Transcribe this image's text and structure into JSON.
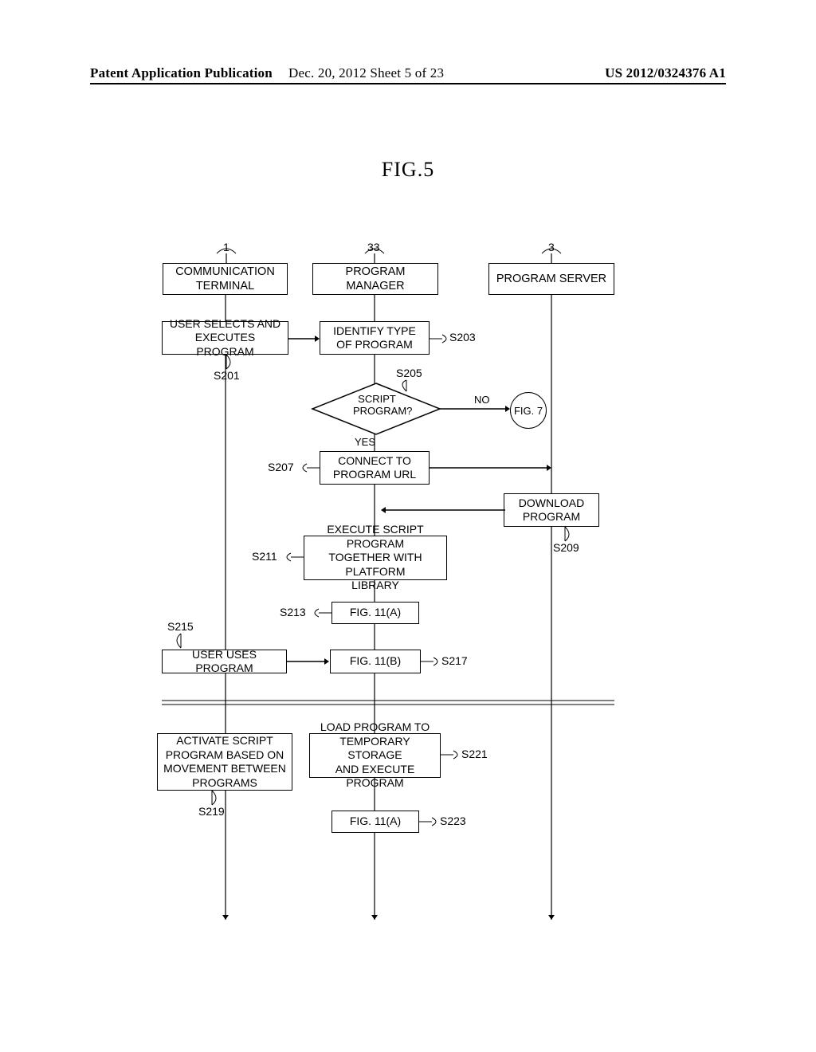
{
  "header": {
    "left": "Patent Application Publication",
    "mid": "Dec. 20, 2012  Sheet 5 of 23",
    "right": "US 2012/0324376 A1"
  },
  "figure_title": "FIG.5",
  "swim": {
    "col1": {
      "ref": "1",
      "title": "COMMUNICATION\nTERMINAL"
    },
    "col2": {
      "ref": "33",
      "title": "PROGRAM MANAGER"
    },
    "col3": {
      "ref": "3",
      "title": "PROGRAM SERVER"
    }
  },
  "steps": {
    "s201": {
      "id": "S201",
      "text": "USER SELECTS AND\nEXECUTES PROGRAM"
    },
    "s203": {
      "id": "S203",
      "text": "IDENTIFY TYPE\nOF PROGRAM"
    },
    "s205": {
      "id": "S205",
      "text": "SCRIPT\nPROGRAM?",
      "yes": "YES",
      "no": "NO",
      "off_page": "FIG. 7"
    },
    "s207": {
      "id": "S207",
      "text": "CONNECT TO\nPROGRAM URL"
    },
    "s209": {
      "id": "S209",
      "text": "DOWNLOAD\nPROGRAM"
    },
    "s211": {
      "id": "S211",
      "text": "EXECUTE SCRIPT PROGRAM\nTOGETHER WITH PLATFORM\nLIBRARY"
    },
    "s213": {
      "id": "S213",
      "text": "FIG. 11(A)"
    },
    "s215": {
      "id": "S215",
      "text": "USER USES PROGRAM"
    },
    "s217": {
      "id": "S217",
      "text": "FIG. 11(B)"
    },
    "s219": {
      "id": "S219",
      "text": "ACTIVATE SCRIPT\nPROGRAM BASED ON\nMOVEMENT BETWEEN\nPROGRAMS"
    },
    "s221": {
      "id": "S221",
      "text": "LOAD PROGRAM TO\nTEMPORARY STORAGE\nAND EXECUTE PROGRAM"
    },
    "s223": {
      "id": "S223",
      "text": "FIG. 11(A)"
    }
  }
}
